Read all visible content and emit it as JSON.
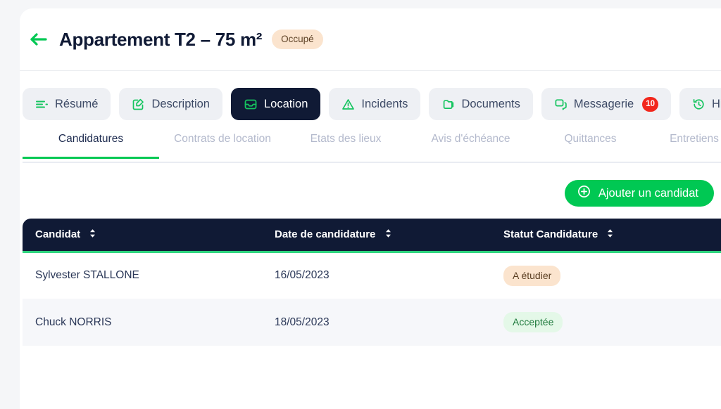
{
  "header": {
    "back_icon": "arrow-left-icon",
    "title": "Appartement T2 – 75 m²",
    "status": "Occupé",
    "status_bg": "#fbe4ce",
    "status_color": "#5c4024"
  },
  "tabs": [
    {
      "label": "Résumé",
      "icon": "list-lines-icon",
      "active": false
    },
    {
      "label": "Description",
      "icon": "edit-square-icon",
      "active": false
    },
    {
      "label": "Location",
      "icon": "inbox-tray-icon",
      "active": true
    },
    {
      "label": "Incidents",
      "icon": "warning-triangle-icon",
      "active": false
    },
    {
      "label": "Documents",
      "icon": "folders-icon",
      "active": false
    },
    {
      "label": "Messagerie",
      "icon": "chat-bubbles-icon",
      "active": false,
      "badge": "10"
    },
    {
      "label": "Historique",
      "icon": "clock-history-icon",
      "active": false
    }
  ],
  "subtabs": [
    {
      "label": "Candidatures",
      "active": true
    },
    {
      "label": "Contrats de location",
      "active": false
    },
    {
      "label": "Etats des lieux",
      "active": false
    },
    {
      "label": "Avis d'échéance",
      "active": false
    },
    {
      "label": "Quittances",
      "active": false
    },
    {
      "label": "Entretiens",
      "active": false
    }
  ],
  "toolbar": {
    "add_label": "Ajouter un candidat",
    "add_icon": "plus-circle-icon",
    "accent": "#00c853"
  },
  "table": {
    "columns": [
      {
        "label": "Candidat",
        "sortable": true
      },
      {
        "label": "Date de candidature",
        "sortable": true
      },
      {
        "label": "Statut Candidature",
        "sortable": true
      }
    ],
    "rows": [
      {
        "candidat": "Sylvester STALLONE",
        "date": "16/05/2023",
        "statut": "A étudier",
        "statut_bg": "#fbe4ce",
        "statut_color": "#5c4024"
      },
      {
        "candidat": "Chuck NORRIS",
        "date": "18/05/2023",
        "statut": "Acceptée",
        "statut_bg": "#e4f8e8",
        "statut_color": "#1f7a3d"
      }
    ]
  },
  "colors": {
    "page_bg": "#f5f6f8",
    "card_bg": "#ffffff",
    "dark": "#101a35",
    "green": "#00c853",
    "badge_red": "#f2271c"
  }
}
